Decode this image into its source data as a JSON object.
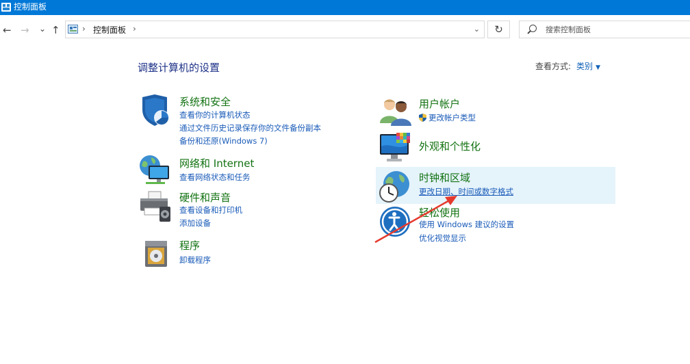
{
  "window": {
    "title": "控制面板"
  },
  "nav": {
    "back_glyph": "←",
    "forward_glyph": "→",
    "recent_glyph": "⌄",
    "up_glyph": "↑",
    "refresh_glyph": "↻"
  },
  "address": {
    "separator": "›",
    "crumb": "控制面板",
    "dropdown_glyph": "⌄"
  },
  "search": {
    "placeholder": "搜索控制面板"
  },
  "header": {
    "title": "调整计算机的设置",
    "view_by_label": "查看方式:",
    "view_by_value": "类别",
    "view_by_caret": "▼"
  },
  "categories": {
    "system_security": {
      "title": "系统和安全",
      "links": [
        "查看你的计算机状态",
        "通过文件历史记录保存你的文件备份副本",
        "备份和还原(Windows 7)"
      ]
    },
    "network": {
      "title": "网络和 Internet",
      "links": [
        "查看网络状态和任务"
      ]
    },
    "hardware": {
      "title": "硬件和声音",
      "links": [
        "查看设备和打印机",
        "添加设备"
      ]
    },
    "programs": {
      "title": "程序",
      "links": [
        "卸载程序"
      ]
    },
    "user_accounts": {
      "title": "用户帐户",
      "links": [
        "更改帐户类型"
      ]
    },
    "appearance": {
      "title": "外观和个性化",
      "links": []
    },
    "clock_region": {
      "title": "时钟和区域",
      "links": [
        "更改日期、时间或数字格式"
      ]
    },
    "ease_of_access": {
      "title": "轻松使用",
      "links": [
        "使用 Windows 建议的设置",
        "优化视觉显示"
      ]
    }
  },
  "annotation": {
    "color": "#e63a2e"
  },
  "colors": {
    "titlebar": "#0078d7",
    "heading": "#127212",
    "link": "#1a5bb8",
    "title": "#1e3287",
    "highlight": "#e5f3fb"
  },
  "icons": [
    "app-icon",
    "control-panel-icon",
    "search-icon",
    "shield-icon",
    "user-accounts-icon",
    "appearance-icon",
    "clock-globe-icon",
    "ease-of-access-icon",
    "network-globe-icon",
    "printer-icon",
    "programs-icon"
  ]
}
